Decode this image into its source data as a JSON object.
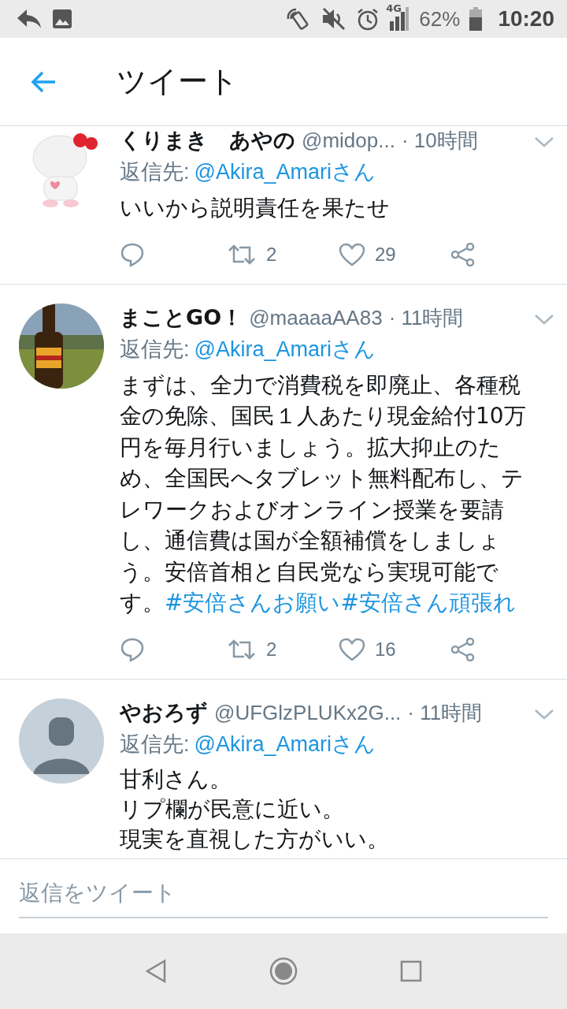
{
  "status_bar": {
    "network": "4G",
    "battery": "62%",
    "time": "10:20"
  },
  "header": {
    "title": "ツイート"
  },
  "tweets": [
    {
      "avatar": {
        "kind": "picture"
      },
      "name": "くりまき　あやの",
      "handle": "@midop...",
      "time": "· 10時間",
      "reply_label": "返信先:",
      "reply_to": "@Akira_Amariさん",
      "text": "いいから説明責任を果たせ",
      "retweets": "2",
      "likes": "29"
    },
    {
      "avatar": {
        "kind": "picture"
      },
      "name": "まことGO！",
      "handle": "@maaaaAA83",
      "time": "· 11時間",
      "reply_label": "返信先:",
      "reply_to": "@Akira_Amariさん",
      "text": "まずは、全力で消費税を即廃止、各種税金の免除、国民１人あたり現金給付10万円を毎月行いましょう。拡大抑止のため、全国民へタブレット無料配布し、テレワークおよびオンライン授業を要請し、通信費は国が全額補償をしましょう。安倍首相と自民党なら実現可能です。",
      "hashtags": [
        "#安倍さんお願い",
        "#安倍さん頑張れ"
      ],
      "retweets": "2",
      "likes": "16"
    },
    {
      "avatar": {
        "kind": "default"
      },
      "name": "やおろず",
      "handle": "@UFGlzPLUKx2G...",
      "time": "· 11時間",
      "reply_label": "返信先:",
      "reply_to": "@Akira_Amariさん",
      "lines": [
        "甘利さん。",
        "リプ欄が民意に近い。",
        "現実を直視した方がいい。"
      ]
    }
  ],
  "composer": {
    "placeholder": "返信をツイート"
  }
}
